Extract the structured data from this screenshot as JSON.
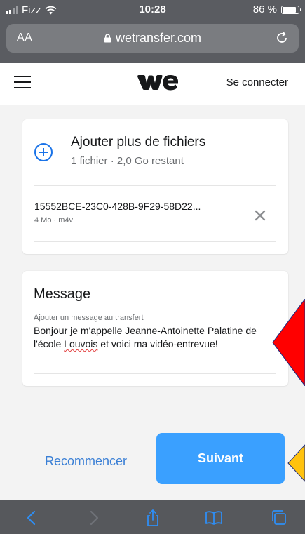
{
  "status_bar": {
    "carrier": "Fizz",
    "time": "10:28",
    "battery": "86 %"
  },
  "browser": {
    "text_size_label": "AA",
    "url": "wetransfer.com"
  },
  "header": {
    "logo_text": "we",
    "signin_label": "Se connecter"
  },
  "files": {
    "add_title": "Ajouter plus de fichiers",
    "add_subtitle": "1 fichier · 2,0 Go restant",
    "items": [
      {
        "name": "15552BCE-23C0-428B-9F29-58D22...",
        "meta": "4 Mo · m4v"
      }
    ]
  },
  "message": {
    "title": "Message",
    "label": "Ajouter un message au transfert",
    "text_part1": "Bonjour je m'appelle Jeanne-Antoinette Palatine de l'école ",
    "text_misspelled": "Louvois",
    "text_part2": " et voici ma vidéo-entrevue!"
  },
  "actions": {
    "restart_label": "Recommencer",
    "next_label": "Suivant"
  },
  "colors": {
    "accent": "#3aa0ff",
    "link": "#3a7fd5",
    "plus_icon": "#1a73e8",
    "annotation_red": "#ff0000",
    "annotation_yellow": "#ffc20e"
  }
}
